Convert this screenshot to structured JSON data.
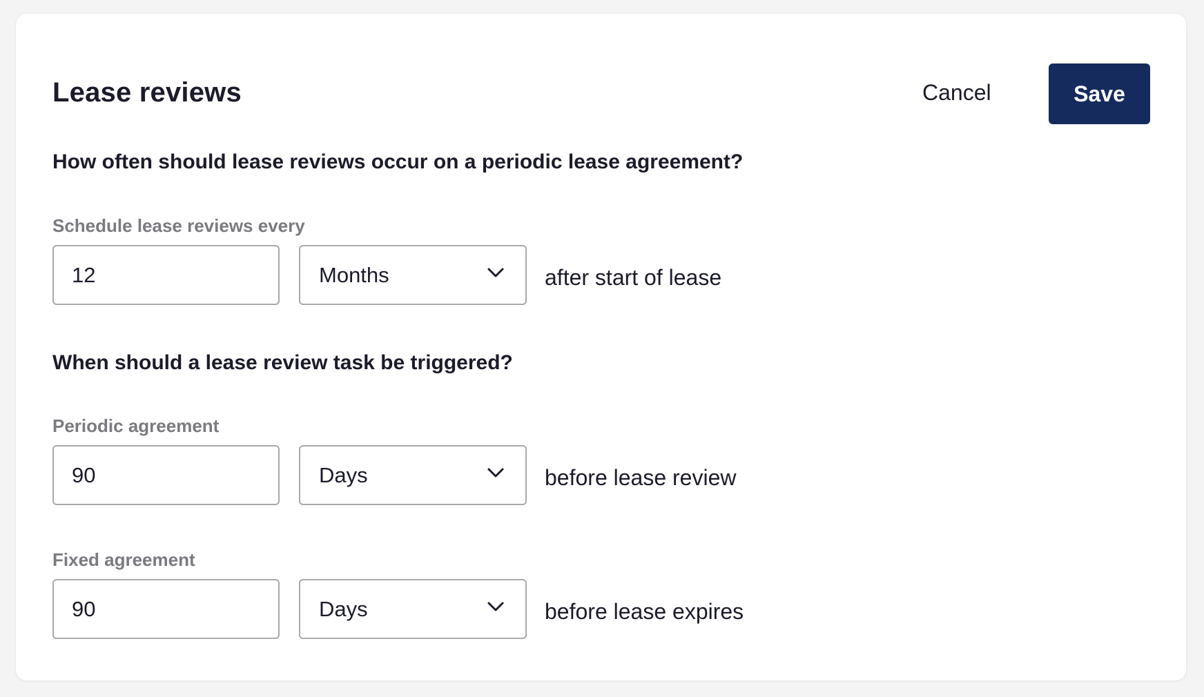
{
  "header": {
    "title": "Lease reviews",
    "cancel_label": "Cancel",
    "save_label": "Save"
  },
  "schedule_section": {
    "question": "How often should lease reviews occur on a periodic lease agreement?",
    "label": "Schedule lease reviews every",
    "value": "12",
    "unit": "Months",
    "suffix": "after start of lease"
  },
  "trigger_section": {
    "question": "When should a lease review task be triggered?",
    "periodic": {
      "label": "Periodic agreement",
      "value": "90",
      "unit": "Days",
      "suffix": "before lease review"
    },
    "fixed": {
      "label": "Fixed agreement",
      "value": "90",
      "unit": "Days",
      "suffix": "before lease expires"
    }
  },
  "icons": {
    "dropdown": "chevron-down-icon"
  },
  "colors": {
    "primary": "#162b5d",
    "text": "#1b1b2b",
    "muted": "#7a7a80",
    "border": "#a9a9ad"
  }
}
